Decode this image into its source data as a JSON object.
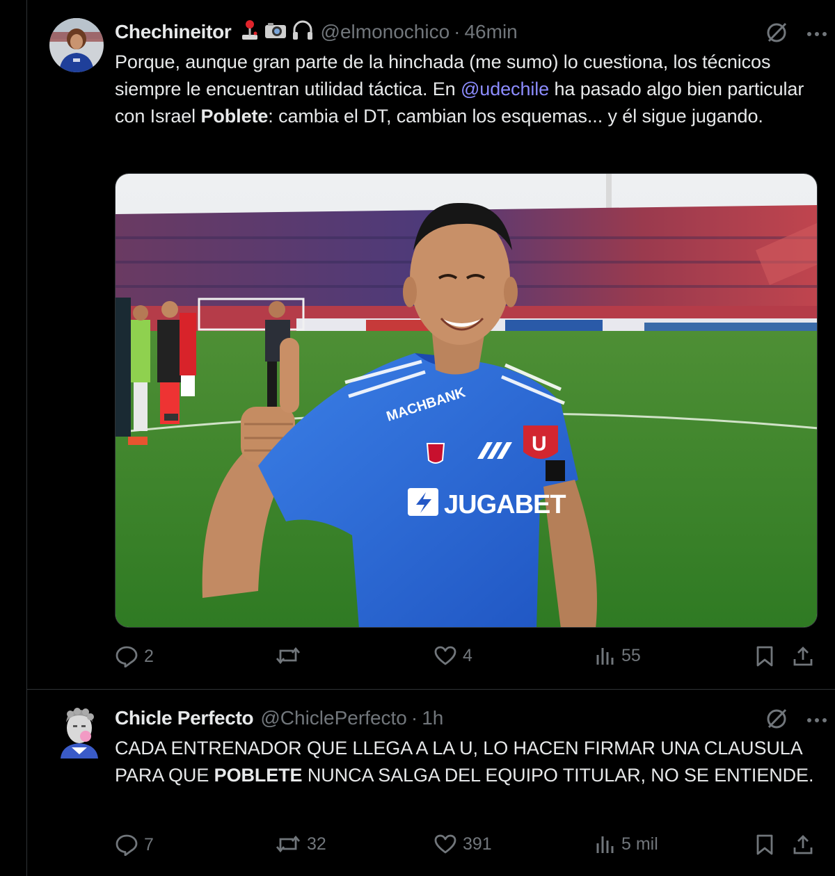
{
  "tweets": [
    {
      "name": "Chechineitor",
      "emojis": [
        "joystick-icon",
        "camera-icon",
        "headphones-icon"
      ],
      "handle": "@elmonochico",
      "separator": "·",
      "time": "46min",
      "text_parts": [
        "Porque, aunque gran parte de la hinchada (me sumo) lo cuestiona, los técnicos siempre le encuentran utilidad táctica. En ",
        "@udechile",
        " ha pasado algo bien particular con Israel ",
        "Poblete",
        ": cambia el DT, cambian los esquemas... y él sigue jugando."
      ],
      "stats": {
        "replies": "2",
        "reposts": "",
        "likes": "4",
        "views": "55"
      }
    },
    {
      "name": "Chicle Perfecto",
      "handle": "@ChiclePerfecto",
      "separator": "·",
      "time": "1h",
      "text_parts": [
        "CADA ENTRENADOR QUE LLEGA A LA U, LO HACEN FIRMAR UNA CLAUSULA PARA QUE ",
        "POBLETE",
        " NUNCA SALGA DEL EQUIPO TITULAR, NO SE ENTIENDE."
      ],
      "stats": {
        "replies": "7",
        "reposts": "32",
        "likes": "391",
        "views": "5 mil"
      }
    }
  ],
  "photo": {
    "jersey_sponsor_chest": "MACHBANK",
    "jersey_sponsor_front": "JUGABET",
    "jersey_crest": "U"
  },
  "colors": {
    "background": "#000000",
    "text": "#e7e9ea",
    "muted": "#71767b",
    "mention": "#8c8cff",
    "border": "#2f3336",
    "jersey_blue": "#2b6ad6",
    "pitch_green": "#3f8a2c"
  }
}
